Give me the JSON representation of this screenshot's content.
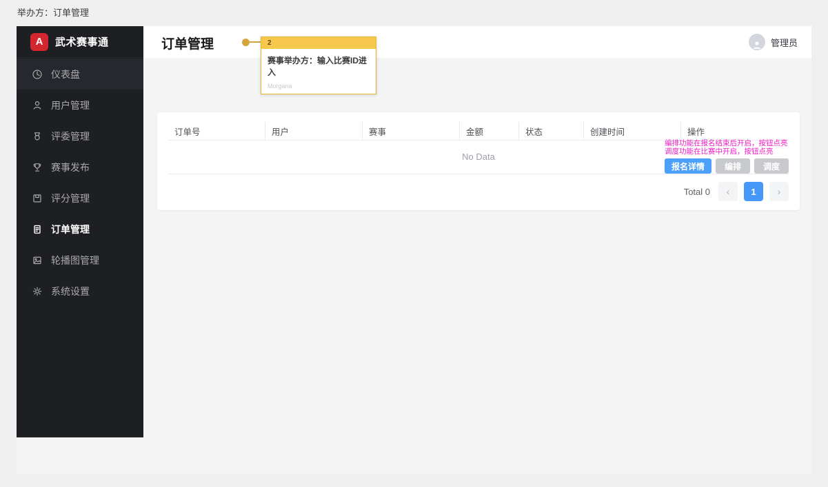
{
  "page": {
    "breadcrumb": "举办方：订单管理"
  },
  "sidebar": {
    "logo_letter": "A",
    "app_title": "武术赛事通",
    "items": [
      {
        "label": "仪表盘"
      },
      {
        "label": "用户管理"
      },
      {
        "label": "评委管理"
      },
      {
        "label": "赛事发布"
      },
      {
        "label": "评分管理"
      },
      {
        "label": "订单管理"
      },
      {
        "label": "轮播图管理"
      },
      {
        "label": "系统设置"
      }
    ],
    "active_item": "订单管理"
  },
  "header": {
    "title": "订单管理",
    "user_label": "管理员"
  },
  "annotation": {
    "number": "2",
    "text": "赛事举办方：输入比赛ID进入",
    "author": "Morgana"
  },
  "table": {
    "columns": [
      "订单号",
      "用户",
      "赛事",
      "金额",
      "状态",
      "创建时间",
      "操作"
    ],
    "empty_text": "No Data",
    "action_note_line1": "编排功能在报名结束后开启，按钮点亮",
    "action_note_line2": "调度功能在比赛中开启，按钮点亮",
    "buttons": [
      {
        "label": "报名详情"
      },
      {
        "label": "编排"
      },
      {
        "label": "调度"
      }
    ]
  },
  "pagination": {
    "total_text": "Total 0",
    "prev": "‹",
    "page": "1",
    "next": "›"
  },
  "colors": {
    "brand_red": "#d4262e",
    "sidebar_bg": "#1e1f23",
    "annotation_yellow": "#f6c84c",
    "note_pink": "#f01ec4",
    "primary_blue": "#4aa0fb",
    "disabled_gray": "#c7c9cd",
    "pagination_blue": "#4598f8",
    "content_bg": "#f4f4f5"
  }
}
